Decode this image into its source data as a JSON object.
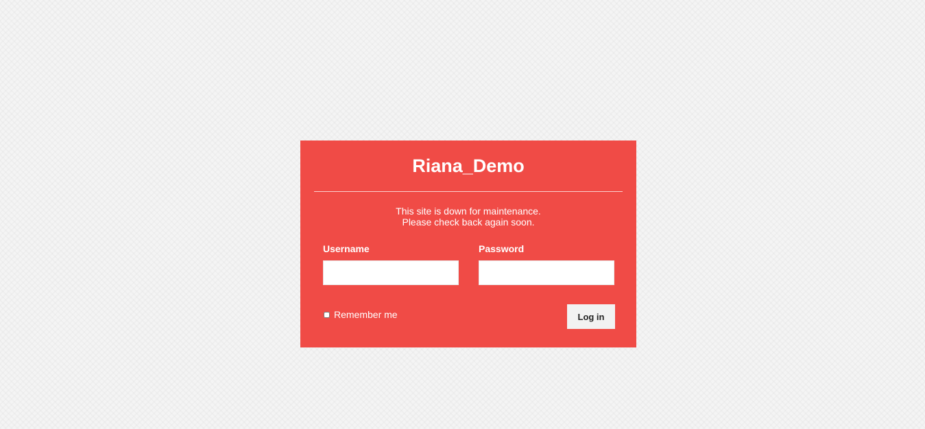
{
  "site": {
    "title": "Riana_Demo"
  },
  "notice": {
    "line1": "This site is down for maintenance.",
    "line2": "Please check back again soon."
  },
  "login_form": {
    "username_label": "Username",
    "username_value": "",
    "password_label": "Password",
    "password_value": "",
    "remember_label": "Remember me",
    "remember_checked": false,
    "submit_label": "Log in"
  },
  "colors": {
    "panel_background": "#f04b46",
    "page_background": "#f4f4f4",
    "text": "#ffffff",
    "button_background": "#f2f2f2"
  }
}
